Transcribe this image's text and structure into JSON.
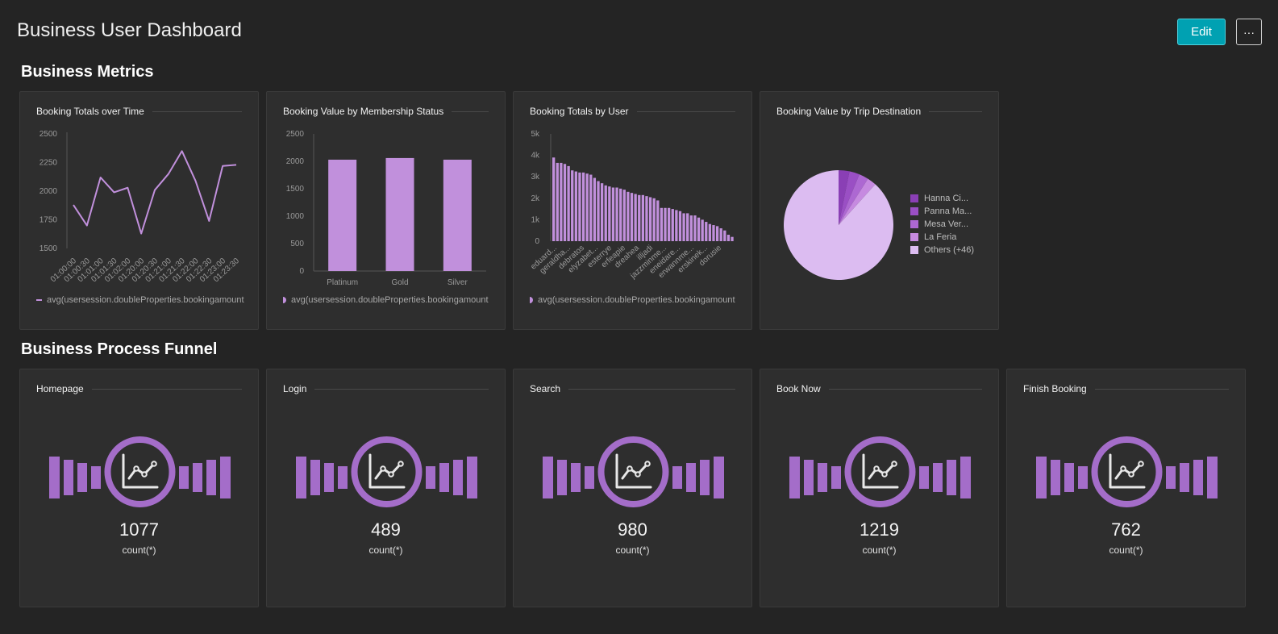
{
  "header": {
    "title": "Business User Dashboard",
    "edit_label": "Edit",
    "more_label": "···"
  },
  "sections": {
    "metrics_title": "Business Metrics",
    "funnel_title": "Business Process Funnel"
  },
  "colors": {
    "accent_button": "#00a1b2",
    "series": "#c190dc",
    "funnel_icon": "#a46dc9"
  },
  "metrics": [
    {
      "title": "Booking Totals over Time",
      "legend": "avg(usersession.doubleProperties.bookingamount"
    },
    {
      "title": "Booking Value by Membership Status",
      "legend": "avg(usersession.doubleProperties.bookingamount"
    },
    {
      "title": "Booking Totals by User",
      "legend": "avg(usersession.doubleProperties.bookingamount"
    },
    {
      "title": "Booking Value by Trip Destination",
      "legend": ""
    }
  ],
  "funnel": [
    {
      "title": "Homepage",
      "value": "1077",
      "unit": "count(*)",
      "icon": "line-chart-icon"
    },
    {
      "title": "Login",
      "value": "489",
      "unit": "count(*)",
      "icon": "line-chart-icon"
    },
    {
      "title": "Search",
      "value": "980",
      "unit": "count(*)",
      "icon": "line-chart-icon"
    },
    {
      "title": "Book Now",
      "value": "1219",
      "unit": "count(*)",
      "icon": "line-chart-icon"
    },
    {
      "title": "Finish Booking",
      "value": "762",
      "unit": "count(*)",
      "icon": "line-chart-icon"
    }
  ],
  "chart_data": [
    {
      "type": "line",
      "title": "Booking Totals over Time",
      "x": [
        "01:00:00",
        "01:00:30",
        "01:01:00",
        "01:01:30",
        "01:02:00",
        "01:20:00",
        "01:20:30",
        "01:21:00",
        "01:21:30",
        "01:22:00",
        "01:22:30",
        "01:23:00",
        "01:23:30"
      ],
      "x_tick_labels": [
        "01:00:00",
        "01:00:30",
        "01:01:00",
        "01:01:30",
        "01:02:00",
        "01:20:00",
        "01:20:30",
        "01:21:00",
        "01:21:30",
        "01:22:00",
        "01:22:30",
        "01:23:00",
        "01:23:30"
      ],
      "series": [
        {
          "name": "avg(usersession.doubleProperties.bookingamount",
          "values": [
            1880,
            1700,
            2120,
            1990,
            2030,
            1630,
            2010,
            2150,
            2350,
            2090,
            1740,
            2220,
            2230
          ]
        }
      ],
      "y_ticks": [
        "2500",
        "2250",
        "2000",
        "1750",
        "1500"
      ],
      "ylim": [
        1500,
        2500
      ],
      "grid": false,
      "legend": "bottom"
    },
    {
      "type": "bar",
      "title": "Booking Value by Membership Status",
      "categories": [
        "Platinum",
        "Gold",
        "Silver"
      ],
      "series": [
        {
          "name": "avg(usersession.doubleProperties.bookingamount",
          "values": [
            2030,
            2060,
            2030
          ]
        }
      ],
      "y_ticks": [
        "2500",
        "2000",
        "1500",
        "1000",
        "500",
        "0"
      ],
      "ylim": [
        0,
        2500
      ],
      "grid": false,
      "legend": "bottom"
    },
    {
      "type": "bar",
      "title": "Booking Totals by User",
      "categories": [
        "eduard...",
        "geraldha...",
        "debratos",
        "elyzabet...",
        "esterrye",
        "erfeapie",
        "dreahea",
        "illjadi",
        "jazzminme...",
        "eneidare...",
        "erwannme...",
        "erskinek...",
        "dorusie"
      ],
      "series": [
        {
          "name": "avg(usersession.doubleProperties.bookingamount",
          "values": [
            3900,
            3650,
            3650,
            3600,
            3500,
            3300,
            3250,
            3200,
            3200,
            3150,
            3100,
            2950,
            2800,
            2700,
            2600,
            2550,
            2500,
            2500,
            2450,
            2400,
            2300,
            2250,
            2200,
            2150,
            2150,
            2100,
            2050,
            2000,
            1900,
            1550,
            1550,
            1550,
            1500,
            1450,
            1400,
            1300,
            1300,
            1200,
            1200,
            1100,
            1000,
            900,
            800,
            750,
            700,
            600,
            500,
            300,
            200
          ]
        }
      ],
      "y_ticks": [
        "5k",
        "4k",
        "3k",
        "2k",
        "1k",
        "0"
      ],
      "ylim": [
        0,
        5000
      ],
      "grid": false,
      "legend": "bottom"
    },
    {
      "type": "pie",
      "title": "Booking Value by Trip Destination",
      "slices": [
        {
          "name": "Hanna Ci...",
          "value": 3.2,
          "color": "#8a3fb5"
        },
        {
          "name": "Panna Ma...",
          "value": 3.0,
          "color": "#9a4fc4"
        },
        {
          "name": "Mesa Ver...",
          "value": 2.8,
          "color": "#ad68d2"
        },
        {
          "name": "La Feria",
          "value": 2.7,
          "color": "#c68ae0"
        },
        {
          "name": "Others (+46)",
          "value": 88.3,
          "color": "#dcbcf1"
        }
      ],
      "legend": "right"
    }
  ]
}
